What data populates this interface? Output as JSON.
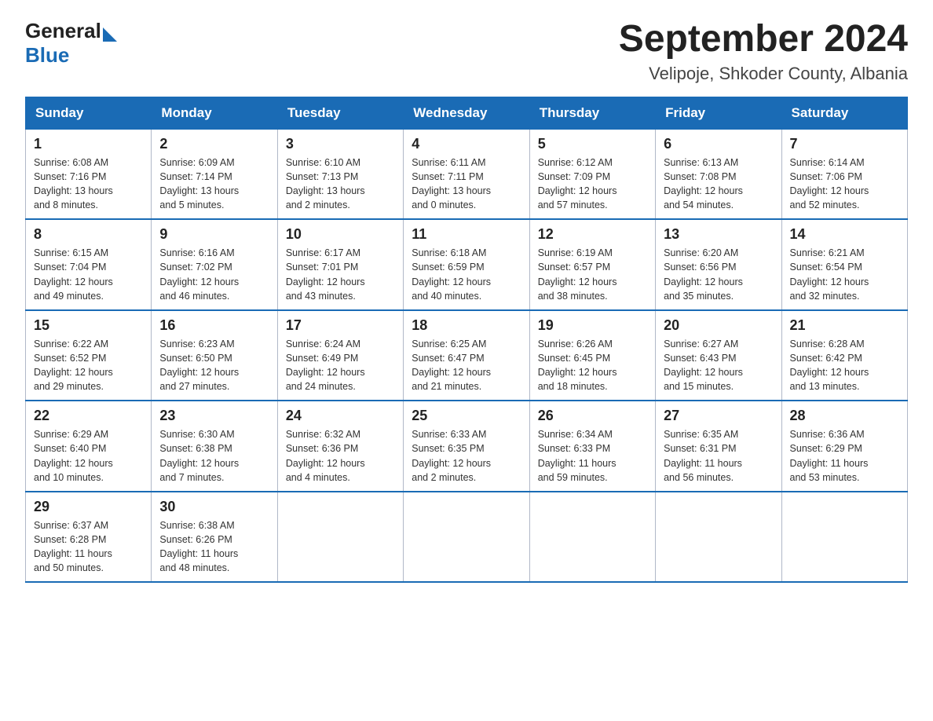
{
  "header": {
    "logo_general": "General",
    "logo_blue": "Blue",
    "title": "September 2024",
    "subtitle": "Velipoje, Shkoder County, Albania"
  },
  "columns": [
    "Sunday",
    "Monday",
    "Tuesday",
    "Wednesday",
    "Thursday",
    "Friday",
    "Saturday"
  ],
  "weeks": [
    [
      {
        "day": "1",
        "info": "Sunrise: 6:08 AM\nSunset: 7:16 PM\nDaylight: 13 hours\nand 8 minutes."
      },
      {
        "day": "2",
        "info": "Sunrise: 6:09 AM\nSunset: 7:14 PM\nDaylight: 13 hours\nand 5 minutes."
      },
      {
        "day": "3",
        "info": "Sunrise: 6:10 AM\nSunset: 7:13 PM\nDaylight: 13 hours\nand 2 minutes."
      },
      {
        "day": "4",
        "info": "Sunrise: 6:11 AM\nSunset: 7:11 PM\nDaylight: 13 hours\nand 0 minutes."
      },
      {
        "day": "5",
        "info": "Sunrise: 6:12 AM\nSunset: 7:09 PM\nDaylight: 12 hours\nand 57 minutes."
      },
      {
        "day": "6",
        "info": "Sunrise: 6:13 AM\nSunset: 7:08 PM\nDaylight: 12 hours\nand 54 minutes."
      },
      {
        "day": "7",
        "info": "Sunrise: 6:14 AM\nSunset: 7:06 PM\nDaylight: 12 hours\nand 52 minutes."
      }
    ],
    [
      {
        "day": "8",
        "info": "Sunrise: 6:15 AM\nSunset: 7:04 PM\nDaylight: 12 hours\nand 49 minutes."
      },
      {
        "day": "9",
        "info": "Sunrise: 6:16 AM\nSunset: 7:02 PM\nDaylight: 12 hours\nand 46 minutes."
      },
      {
        "day": "10",
        "info": "Sunrise: 6:17 AM\nSunset: 7:01 PM\nDaylight: 12 hours\nand 43 minutes."
      },
      {
        "day": "11",
        "info": "Sunrise: 6:18 AM\nSunset: 6:59 PM\nDaylight: 12 hours\nand 40 minutes."
      },
      {
        "day": "12",
        "info": "Sunrise: 6:19 AM\nSunset: 6:57 PM\nDaylight: 12 hours\nand 38 minutes."
      },
      {
        "day": "13",
        "info": "Sunrise: 6:20 AM\nSunset: 6:56 PM\nDaylight: 12 hours\nand 35 minutes."
      },
      {
        "day": "14",
        "info": "Sunrise: 6:21 AM\nSunset: 6:54 PM\nDaylight: 12 hours\nand 32 minutes."
      }
    ],
    [
      {
        "day": "15",
        "info": "Sunrise: 6:22 AM\nSunset: 6:52 PM\nDaylight: 12 hours\nand 29 minutes."
      },
      {
        "day": "16",
        "info": "Sunrise: 6:23 AM\nSunset: 6:50 PM\nDaylight: 12 hours\nand 27 minutes."
      },
      {
        "day": "17",
        "info": "Sunrise: 6:24 AM\nSunset: 6:49 PM\nDaylight: 12 hours\nand 24 minutes."
      },
      {
        "day": "18",
        "info": "Sunrise: 6:25 AM\nSunset: 6:47 PM\nDaylight: 12 hours\nand 21 minutes."
      },
      {
        "day": "19",
        "info": "Sunrise: 6:26 AM\nSunset: 6:45 PM\nDaylight: 12 hours\nand 18 minutes."
      },
      {
        "day": "20",
        "info": "Sunrise: 6:27 AM\nSunset: 6:43 PM\nDaylight: 12 hours\nand 15 minutes."
      },
      {
        "day": "21",
        "info": "Sunrise: 6:28 AM\nSunset: 6:42 PM\nDaylight: 12 hours\nand 13 minutes."
      }
    ],
    [
      {
        "day": "22",
        "info": "Sunrise: 6:29 AM\nSunset: 6:40 PM\nDaylight: 12 hours\nand 10 minutes."
      },
      {
        "day": "23",
        "info": "Sunrise: 6:30 AM\nSunset: 6:38 PM\nDaylight: 12 hours\nand 7 minutes."
      },
      {
        "day": "24",
        "info": "Sunrise: 6:32 AM\nSunset: 6:36 PM\nDaylight: 12 hours\nand 4 minutes."
      },
      {
        "day": "25",
        "info": "Sunrise: 6:33 AM\nSunset: 6:35 PM\nDaylight: 12 hours\nand 2 minutes."
      },
      {
        "day": "26",
        "info": "Sunrise: 6:34 AM\nSunset: 6:33 PM\nDaylight: 11 hours\nand 59 minutes."
      },
      {
        "day": "27",
        "info": "Sunrise: 6:35 AM\nSunset: 6:31 PM\nDaylight: 11 hours\nand 56 minutes."
      },
      {
        "day": "28",
        "info": "Sunrise: 6:36 AM\nSunset: 6:29 PM\nDaylight: 11 hours\nand 53 minutes."
      }
    ],
    [
      {
        "day": "29",
        "info": "Sunrise: 6:37 AM\nSunset: 6:28 PM\nDaylight: 11 hours\nand 50 minutes."
      },
      {
        "day": "30",
        "info": "Sunrise: 6:38 AM\nSunset: 6:26 PM\nDaylight: 11 hours\nand 48 minutes."
      },
      {
        "day": "",
        "info": ""
      },
      {
        "day": "",
        "info": ""
      },
      {
        "day": "",
        "info": ""
      },
      {
        "day": "",
        "info": ""
      },
      {
        "day": "",
        "info": ""
      }
    ]
  ]
}
